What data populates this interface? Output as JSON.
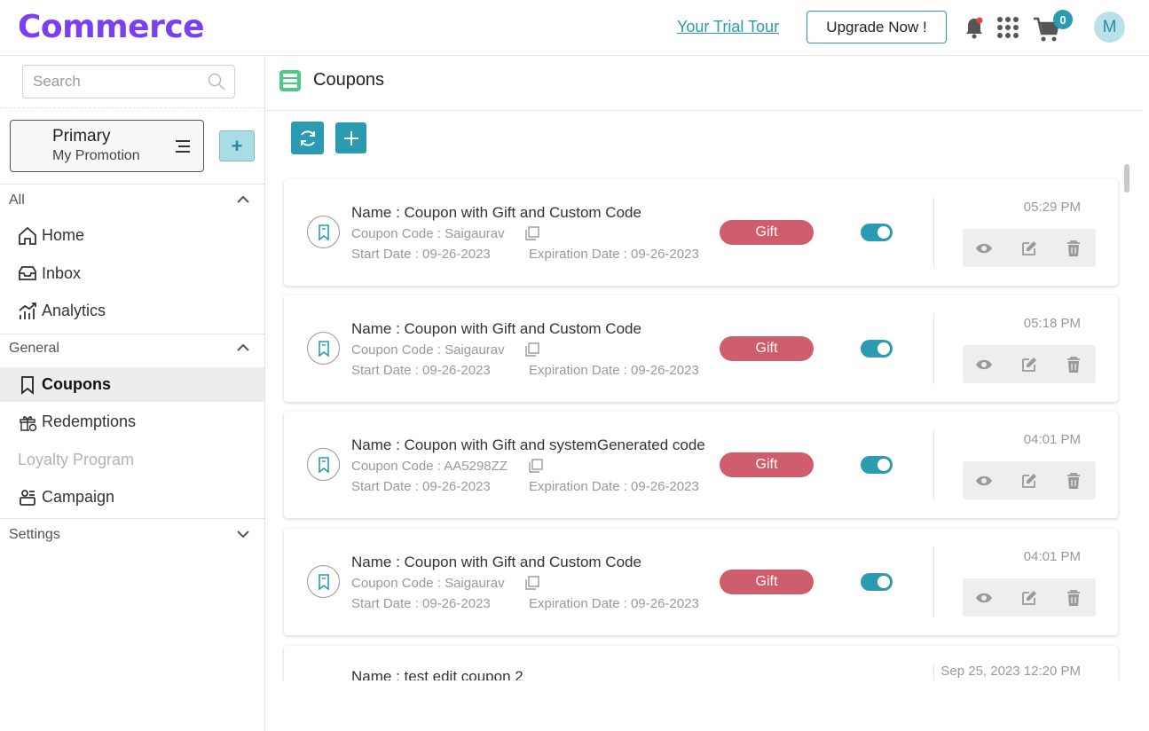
{
  "brand": {
    "logo_text": "Commerce",
    "color": "#7a3ff0"
  },
  "header": {
    "trial_link": "Your Trial Tour",
    "upgrade_label": "Upgrade Now !",
    "cart_count": "0",
    "avatar_initial": "M",
    "icons": [
      "bell-icon",
      "apps-grid-icon",
      "cart-icon"
    ]
  },
  "sidebar": {
    "search_placeholder": "Search",
    "selector": {
      "title": "Primary",
      "subtitle": "My Promotion"
    },
    "add_label": "+",
    "sections": [
      {
        "label": "All",
        "items": [
          "Home",
          "Inbox",
          "Analytics"
        ]
      },
      {
        "label": "General",
        "items": [
          "Coupons",
          "Redemptions",
          "Loyalty Program",
          "Campaign"
        ]
      },
      {
        "label": "Settings",
        "items": []
      }
    ],
    "active_item": "Coupons",
    "disabled_item": "Loyalty Program"
  },
  "main": {
    "title": "Coupons",
    "toolbar": [
      "refresh-icon",
      "plus-icon"
    ]
  },
  "coupons": [
    {
      "name": "Name : Coupon with Gift and Custom Code",
      "code": "Coupon Code : Saigaurav",
      "start": "Start Date : 09-26-2023",
      "expiration": "Expiration Date : 09-26-2023",
      "type": "Gift",
      "enabled": true,
      "time": "05:29 PM"
    },
    {
      "name": "Name : Coupon with Gift and Custom Code",
      "code": "Coupon Code : Saigaurav",
      "start": "Start Date : 09-26-2023",
      "expiration": "Expiration Date : 09-26-2023",
      "type": "Gift",
      "enabled": true,
      "time": "05:18 PM"
    },
    {
      "name": "Name : Coupon with Gift and systemGenerated code",
      "code": "Coupon Code : AA5298ZZ",
      "start": "Start Date : 09-26-2023",
      "expiration": "Expiration Date : 09-26-2023",
      "type": "Gift",
      "enabled": true,
      "time": "04:01 PM"
    },
    {
      "name": "Name : Coupon with Gift and Custom Code",
      "code": "Coupon Code : Saigaurav",
      "start": "Start Date : 09-26-2023",
      "expiration": "Expiration Date : 09-26-2023",
      "type": "Gift",
      "enabled": true,
      "time": "04:01 PM"
    },
    {
      "name": "Name : test edit coupon 2",
      "code": "",
      "start": "",
      "expiration": "",
      "type": "",
      "enabled": true,
      "time": "Sep 25, 2023 12:20 PM"
    }
  ],
  "colors": {
    "accent": "#2a9bb0",
    "gift_badge": "#cf5d6b"
  }
}
